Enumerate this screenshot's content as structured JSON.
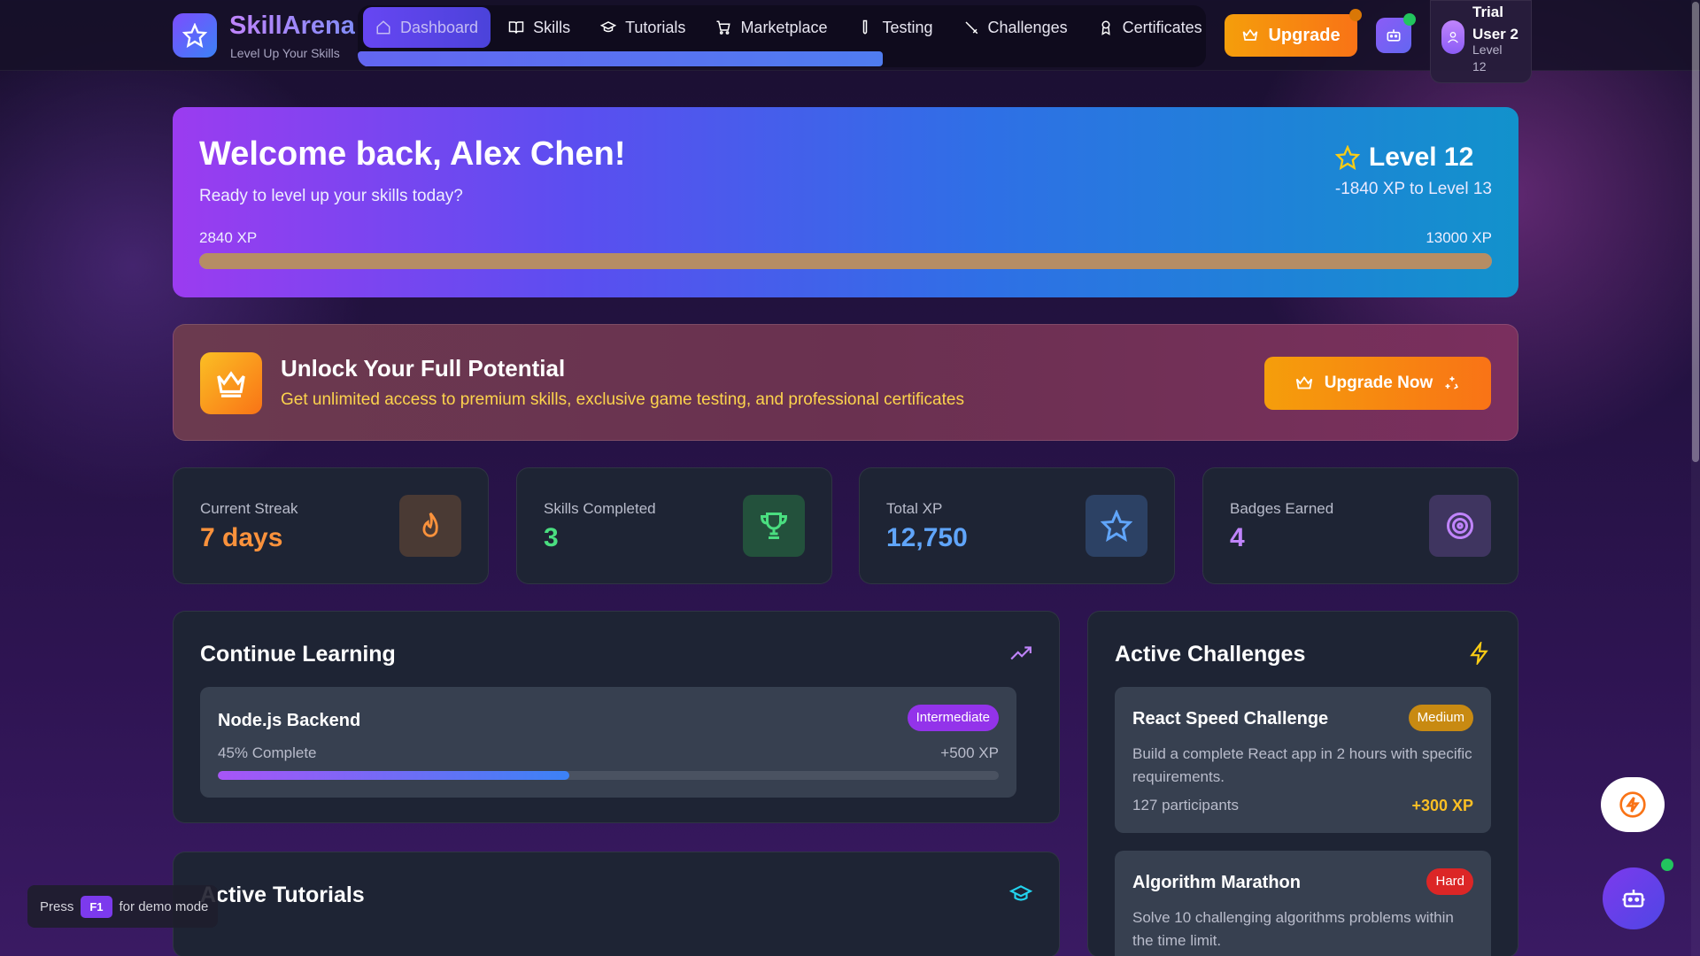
{
  "brand": {
    "name": "SkillArena",
    "tagline": "Level Up Your Skills"
  },
  "nav": {
    "items": [
      {
        "label": "Dashboard",
        "icon": "home-icon",
        "active": true
      },
      {
        "label": "Skills",
        "icon": "book-icon"
      },
      {
        "label": "Tutorials",
        "icon": "graduation-cap-icon"
      },
      {
        "label": "Marketplace",
        "icon": "cart-icon"
      },
      {
        "label": "Testing",
        "icon": "test-tube-icon"
      },
      {
        "label": "Challenges",
        "icon": "sword-icon"
      },
      {
        "label": "Certificates",
        "icon": "award-icon"
      }
    ]
  },
  "header": {
    "upgrade_label": "Upgrade",
    "user": {
      "name": "Trial User 2",
      "level": "Level 12"
    }
  },
  "welcome": {
    "title": "Welcome back, Alex Chen!",
    "subtitle": "Ready to level up your skills today?",
    "level": "Level 12",
    "to_next": "-1840 XP to Level 13",
    "xp_current": "2840 XP",
    "xp_max": "13000 XP",
    "xp_fraction": 1.0
  },
  "promo": {
    "title": "Unlock Your Full Potential",
    "subtitle": "Get unlimited access to premium skills, exclusive game testing, and professional certificates",
    "button": "Upgrade Now"
  },
  "stats": [
    {
      "label": "Current Streak",
      "value": "7 days",
      "color": "#fb923c",
      "icon": "flame-icon"
    },
    {
      "label": "Skills Completed",
      "value": "3",
      "color": "#4ade80",
      "icon": "trophy-icon"
    },
    {
      "label": "Total XP",
      "value": "12,750",
      "color": "#60a5fa",
      "icon": "star-icon"
    },
    {
      "label": "Badges Earned",
      "value": "4",
      "color": "#c084fc",
      "icon": "target-icon"
    }
  ],
  "continue_learning": {
    "title": "Continue Learning",
    "course": {
      "name": "Node.js Backend",
      "level": "Intermediate",
      "progress_text": "45% Complete",
      "progress": 0.45,
      "xp": "+500 XP"
    }
  },
  "active_tutorials": {
    "title": "Active Tutorials"
  },
  "active_challenges": {
    "title": "Active Challenges",
    "items": [
      {
        "name": "React Speed Challenge",
        "difficulty": "Medium",
        "description": "Build a complete React app in 2 hours with specific requirements.",
        "participants": "127 participants",
        "xp": "+300 XP"
      },
      {
        "name": "Algorithm Marathon",
        "difficulty": "Hard",
        "description": "Solve 10 challenging algorithms problems within the time limit."
      }
    ]
  },
  "demo_hint": {
    "press": "Press",
    "key": "F1",
    "suffix": "for demo mode"
  },
  "colors": {
    "accent": "#6d4aff",
    "upgrade": "#f59e0b",
    "medium": "#d97706",
    "hard": "#dc2626"
  }
}
